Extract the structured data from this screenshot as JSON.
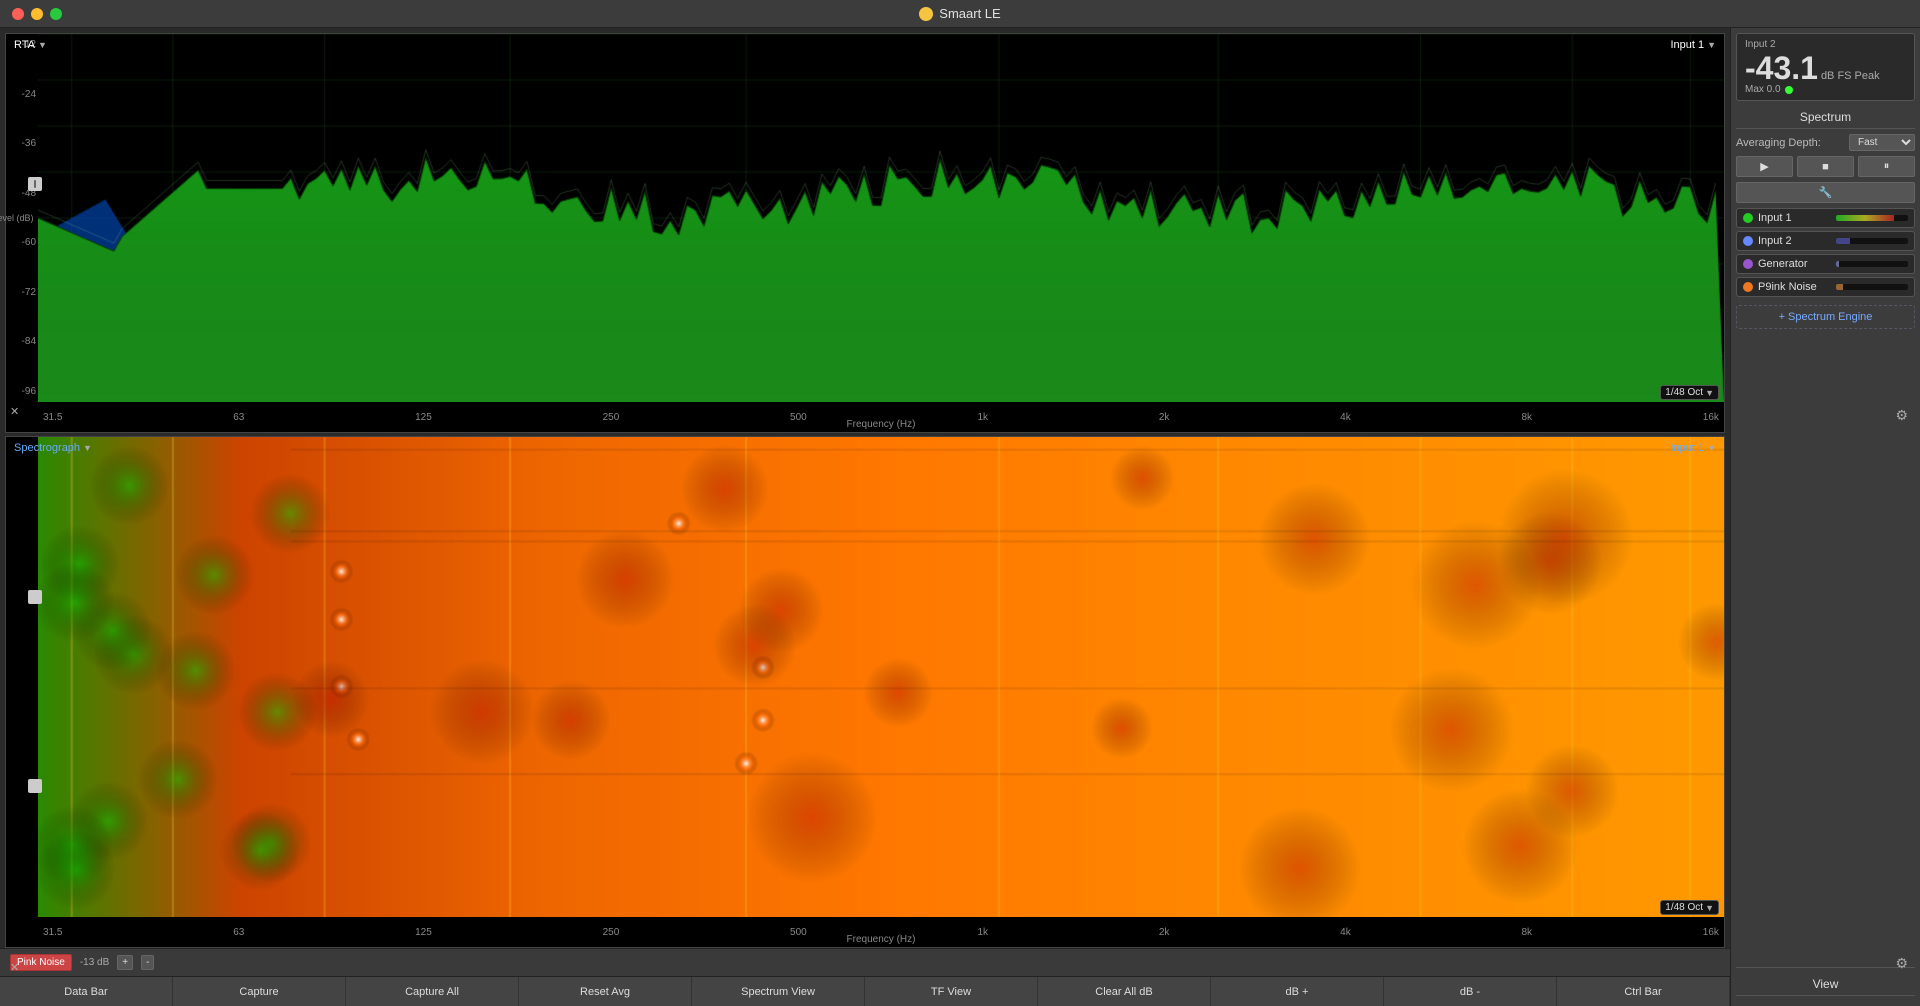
{
  "titlebar": {
    "title": "Smaart LE"
  },
  "rta": {
    "label": "RTA",
    "input_label": "Input 1",
    "y_axis": [
      "-12",
      "-24",
      "-36",
      "-48",
      "-60",
      "-72",
      "-84",
      "-96"
    ],
    "x_axis": [
      "31.5",
      "63",
      "125",
      "250",
      "500",
      "1k",
      "2k",
      "4k",
      "8k",
      "16k"
    ],
    "x_axis_label": "Frequency (Hz)",
    "y_axis_label": "Level (dB)",
    "resolution": "1/48 Oct"
  },
  "spectrograph": {
    "label": "Spectrograph",
    "input_label": "Input 1",
    "x_axis": [
      "31.5",
      "63",
      "125",
      "250",
      "500",
      "1k",
      "2k",
      "4k",
      "8k",
      "16k"
    ],
    "x_axis_label": "Frequency (Hz)",
    "resolution": "1/48 Oct"
  },
  "sidebar": {
    "input_label": "Input 2",
    "db_value": "-43.1",
    "db_unit": "dB FS Peak",
    "max_label": "Max 0.0",
    "spectrum_title": "Spectrum",
    "averaging_depth_label": "Averaging Depth:",
    "averaging_depth_value": "Fast",
    "inputs": [
      {
        "name": "Input 1",
        "color": "#22cc22",
        "meter": 80
      },
      {
        "name": "Input 2",
        "color": "#6688ff",
        "meter": 20
      },
      {
        "name": "Generator",
        "color": "#9955cc",
        "meter": 5
      },
      {
        "name": "P9ink Noise",
        "color": "#ee7722",
        "meter": 10
      }
    ],
    "add_engine_label": "+ Spectrum Engine",
    "view_label": "View",
    "pink_noise_label": "Pink Noise",
    "db_value_small": "-13 dB",
    "db_plus": "+",
    "db_minus": "-"
  },
  "toolbar": {
    "buttons": [
      "Data Bar",
      "Capture",
      "Capture All",
      "Reset Avg",
      "Spectrum View",
      "TF View",
      "Clear All dB",
      "dB +",
      "dB -",
      "Ctrl Bar"
    ]
  }
}
